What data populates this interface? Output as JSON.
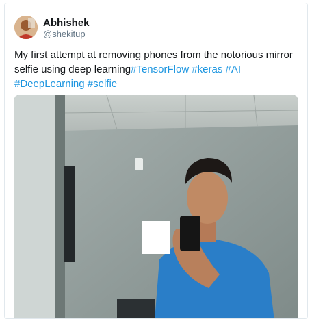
{
  "author": {
    "display_name": "Abhishek",
    "handle": "@shekitup"
  },
  "tweet": {
    "text": "My first attempt at removing phones from the notorious mirror selfie using deep learning",
    "hashtags": [
      "#TensorFlow",
      "#keras",
      "#AI",
      "#DeepLearning",
      "#selfie"
    ]
  },
  "colors": {
    "hashtag": "#1b95e0",
    "handle": "#657786",
    "border": "#e1e8ed"
  },
  "media": {
    "subject": "mirror selfie photo of man in blue t-shirt holding a phone"
  }
}
